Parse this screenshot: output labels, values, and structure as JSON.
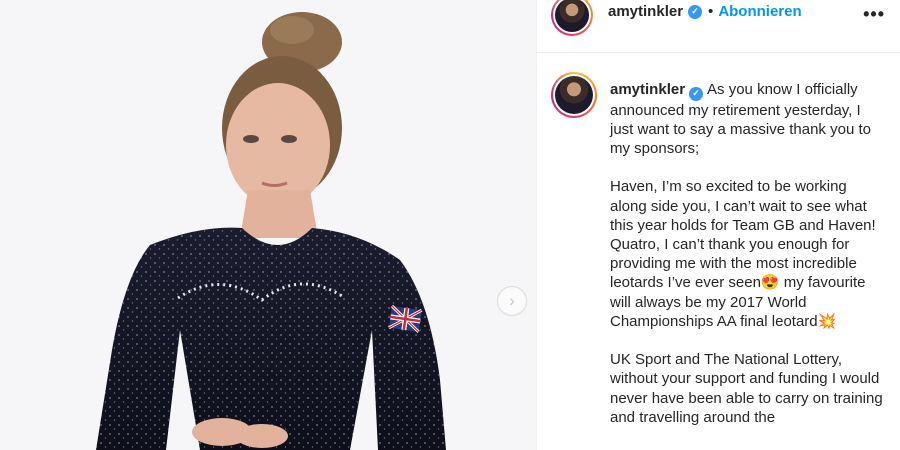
{
  "header": {
    "username": "amytinkler",
    "separator": "•",
    "follow_label": "Abonnieren",
    "more_label": "•••"
  },
  "carousel": {
    "next_label": "›"
  },
  "caption": {
    "username": "amytinkler",
    "lines": [
      "As you know I officially announced my retirement yesterday, I just want to say a massive thank you to my sponsors;",
      "",
      "Haven, I’m so excited to be working along side you, I can’t wait to see what this year holds for Team GB and Haven!",
      "Quatro, I can’t thank you enough for providing me with the most incredible leotards I’ve ever seen😍 my favourite will always be my 2017 World Championships AA final leotard💥",
      "",
      "UK Sport and The National Lottery, without your support and funding I would never have been able to carry on training and travelling around the"
    ]
  },
  "icons": {
    "verified": "verified-badge-icon",
    "more": "more-options-icon",
    "next": "chevron-right-icon"
  },
  "colors": {
    "accent": "#0095f6",
    "verified": "#3897f0",
    "text": "#262626",
    "divider": "#efefef"
  }
}
